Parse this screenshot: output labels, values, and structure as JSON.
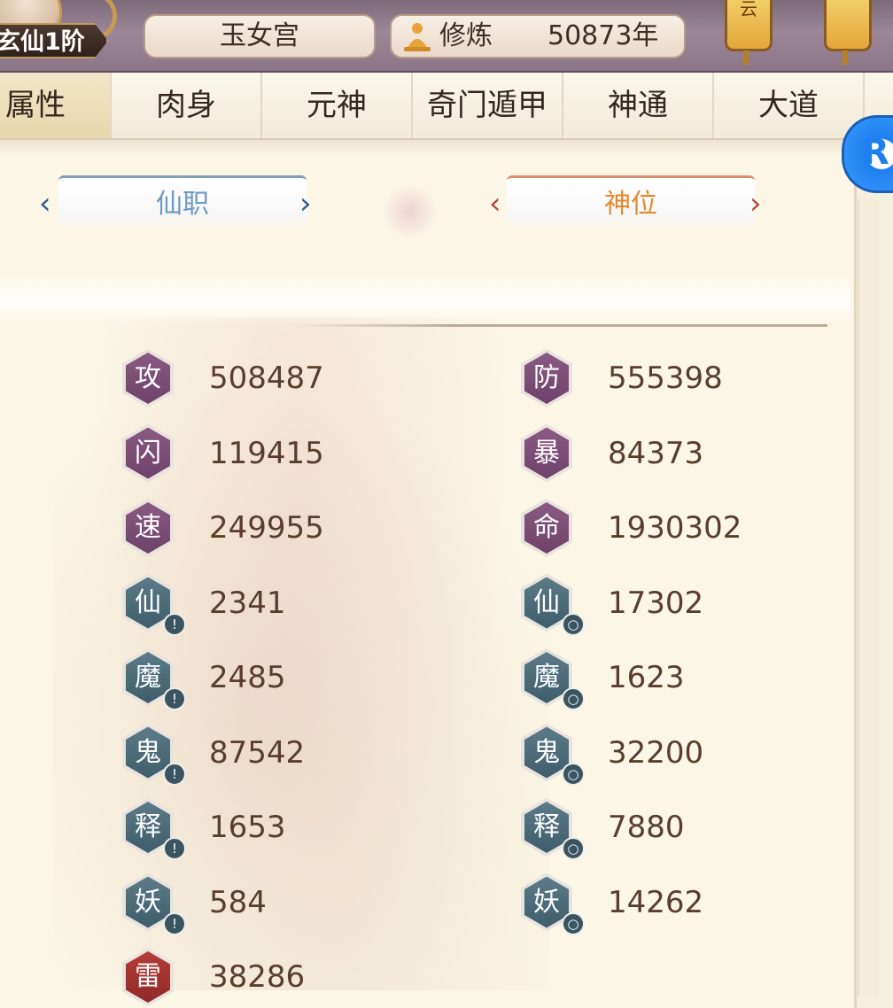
{
  "header": {
    "rank": "玄仙1阶",
    "sect": "玉女宫",
    "cultivation_label": "修炼",
    "cultivation_years": "50873年",
    "lanterns": [
      "云",
      ""
    ]
  },
  "tabs": [
    {
      "label": "属性",
      "active": true
    },
    {
      "label": "肉身",
      "active": false
    },
    {
      "label": "元神",
      "active": false
    },
    {
      "label": "奇门遁甲",
      "active": false
    },
    {
      "label": "神通",
      "active": false
    },
    {
      "label": "大道",
      "active": false
    }
  ],
  "floating_assistant": {
    "letter": "R"
  },
  "titles": {
    "left": "仙职",
    "right": "神位",
    "left_arrow_prev": "‹",
    "left_arrow_next": "›",
    "right_arrow_prev": "‹",
    "right_arrow_next": "›"
  },
  "stats_left": [
    {
      "char": "攻",
      "value": "508487",
      "style": "purple",
      "badge": ""
    },
    {
      "char": "闪",
      "value": "119415",
      "style": "purple",
      "badge": ""
    },
    {
      "char": "速",
      "value": "249955",
      "style": "purple",
      "badge": ""
    },
    {
      "char": "仙",
      "value": "2341",
      "style": "teal",
      "badge": "!"
    },
    {
      "char": "魔",
      "value": "2485",
      "style": "teal",
      "badge": "!"
    },
    {
      "char": "鬼",
      "value": "87542",
      "style": "teal",
      "badge": "!"
    },
    {
      "char": "释",
      "value": "1653",
      "style": "teal",
      "badge": "!"
    },
    {
      "char": "妖",
      "value": "584",
      "style": "teal",
      "badge": "!"
    },
    {
      "char": "雷",
      "value": "38286",
      "style": "red",
      "badge": ""
    }
  ],
  "stats_right": [
    {
      "char": "防",
      "value": "555398",
      "style": "purple",
      "badge": ""
    },
    {
      "char": "暴",
      "value": "84373",
      "style": "purple",
      "badge": ""
    },
    {
      "char": "命",
      "value": "1930302",
      "style": "purple",
      "badge": ""
    },
    {
      "char": "仙",
      "value": "17302",
      "style": "teal",
      "badge": "○"
    },
    {
      "char": "魔",
      "value": "1623",
      "style": "teal",
      "badge": "○"
    },
    {
      "char": "鬼",
      "value": "32200",
      "style": "teal",
      "badge": "○"
    },
    {
      "char": "释",
      "value": "7880",
      "style": "teal",
      "badge": "○"
    },
    {
      "char": "妖",
      "value": "14262",
      "style": "teal",
      "badge": "○"
    }
  ],
  "colors": {
    "purple_hex": "#7a4d74",
    "teal_hex": "#4b6a77",
    "red_hex": "#a63432",
    "value_text": "#5a3d2b"
  }
}
